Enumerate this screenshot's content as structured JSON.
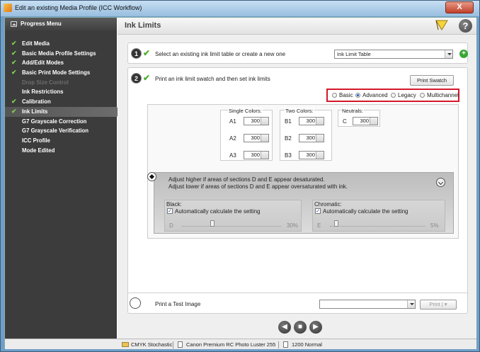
{
  "window": {
    "title": "Edit an existing Media Profile (ICC Workflow)",
    "close_label": "X"
  },
  "sidebar": {
    "header": "Progress Menu",
    "items": [
      {
        "label": "Edit Media",
        "check": "✔",
        "state": "done"
      },
      {
        "label": "Basic Media Profile Settings",
        "check": "✔",
        "state": "done"
      },
      {
        "label": "Add/Edit Modes",
        "check": "✔",
        "state": "done"
      },
      {
        "label": "Basic Print Mode Settings",
        "check": "✔",
        "state": "done"
      },
      {
        "label": "Drop Size Control",
        "check": "",
        "state": "disabled"
      },
      {
        "label": "Ink Restrictions",
        "check": "",
        "state": "normal"
      },
      {
        "label": "Calibration",
        "check": "✔",
        "state": "done"
      },
      {
        "label": "Ink Limits",
        "check": "✔",
        "state": "active"
      },
      {
        "label": "G7 Grayscale Correction",
        "check": "",
        "state": "normal"
      },
      {
        "label": "G7 Grayscale Verification",
        "check": "",
        "state": "normal"
      },
      {
        "label": "ICC Profile",
        "check": "",
        "state": "normal"
      },
      {
        "label": "Mode Edited",
        "check": "",
        "state": "normal"
      }
    ]
  },
  "header": {
    "title": "Ink Limits",
    "help": "?"
  },
  "step1": {
    "number": "1",
    "text": "Select an existing ink limit table or create a new one",
    "combo_value": "Ink Limit Table",
    "plus": "+"
  },
  "step2": {
    "number": "2",
    "text": "Print an ink limit swatch and then set ink limits",
    "print_button": "Print Swatch",
    "modes": [
      {
        "label": "Basic",
        "selected": false
      },
      {
        "label": "Advanced",
        "selected": true
      },
      {
        "label": "Legacy",
        "selected": false
      },
      {
        "label": "Multichannel",
        "selected": false
      }
    ]
  },
  "ink": {
    "single": {
      "label": "Single Colors:",
      "rows": [
        {
          "name": "A1",
          "value": "300"
        },
        {
          "name": "A2",
          "value": "300"
        },
        {
          "name": "A3",
          "value": "300"
        }
      ]
    },
    "two": {
      "label": "Two Colors:",
      "rows": [
        {
          "name": "B1",
          "value": "300"
        },
        {
          "name": "B2",
          "value": "300"
        },
        {
          "name": "B3",
          "value": "300"
        }
      ]
    },
    "neutrals": {
      "label": "Neutrals:",
      "rows": [
        {
          "name": "C",
          "value": "300"
        }
      ]
    }
  },
  "adjust": {
    "line1": "Adjust higher if areas of sections D and E appear desaturated.",
    "line2": "Adjust lower if areas of sections D and E appear oversaturated with ink.",
    "black": {
      "title": "Black:",
      "checkbox": "Automatically calculate the setting",
      "checked": true,
      "letter": "D",
      "value_text": "30%",
      "level": 0.3
    },
    "chromatic": {
      "title": "Chromatic:",
      "checkbox": "Automatically calculate the setting",
      "checked": true,
      "letter": "E",
      "value_text": "5%",
      "level": 0.05
    }
  },
  "test": {
    "text": "Print a Test Image",
    "combo_value": "",
    "print_button": "Print"
  },
  "nav": {
    "back": "◀",
    "stop": "■",
    "next": "▶"
  },
  "status": {
    "item1": "CMYK Stochastic",
    "item2": "Canon Premium RC Photo Luster 255",
    "item3": "1200 Normal"
  }
}
